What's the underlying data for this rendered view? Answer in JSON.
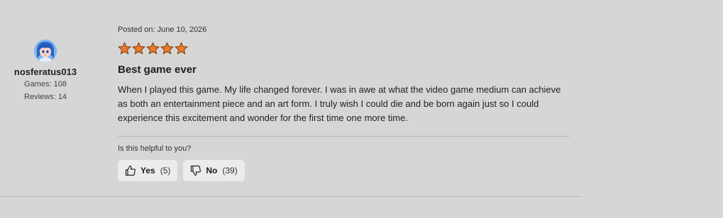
{
  "review": {
    "author": {
      "username": "nosferatus013",
      "games": "Games: 108",
      "reviews": "Reviews: 14"
    },
    "posted": "Posted on: June 10, 2026",
    "rating": 5,
    "rating_max": 5,
    "star_color": "#ea7a2c",
    "title": "Best game ever",
    "body": "When I played this game. My life changed forever. I was in awe at what the video game medium can achieve as both an entertainment piece and an art form. I truly wish I could die and be born again just so I could experience this excitement and wonder for the first time one more time.",
    "helpful_prompt": "Is this helpful to you?",
    "votes": {
      "yes": {
        "label": "Yes",
        "count": "(5)",
        "icon": "thumbs-up-icon"
      },
      "no": {
        "label": "No",
        "count": "(39)",
        "icon": "thumbs-down-icon"
      }
    }
  }
}
